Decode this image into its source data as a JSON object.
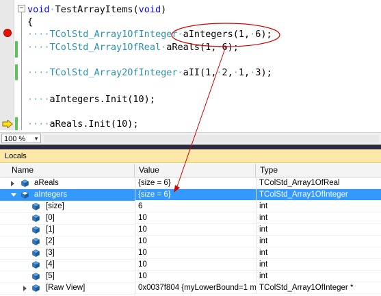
{
  "editor": {
    "lines": [
      {
        "parts": [
          {
            "t": "void",
            "c": "kw"
          },
          {
            "t": "·",
            "c": "dot"
          },
          {
            "t": "TestArrayItems(",
            "c": ""
          },
          {
            "t": "void",
            "c": "kw"
          },
          {
            "t": ")",
            "c": ""
          }
        ]
      },
      {
        "parts": [
          {
            "t": "{",
            "c": ""
          }
        ]
      },
      {
        "parts": [
          {
            "t": "····",
            "c": "dot"
          },
          {
            "t": "TColStd_Array1OfInteger",
            "c": "ty"
          },
          {
            "t": "·",
            "c": "dot"
          },
          {
            "t": "aIntegers(1,",
            "c": ""
          },
          {
            "t": "·",
            "c": "dot"
          },
          {
            "t": "6);",
            "c": ""
          }
        ]
      },
      {
        "parts": [
          {
            "t": "····",
            "c": "dot"
          },
          {
            "t": "TColStd_Array1OfReal",
            "c": "ty"
          },
          {
            "t": "·",
            "c": "dot"
          },
          {
            "t": "aReals(1,",
            "c": ""
          },
          {
            "t": "·",
            "c": "dot"
          },
          {
            "t": "6);",
            "c": ""
          }
        ]
      },
      {
        "parts": []
      },
      {
        "parts": [
          {
            "t": "····",
            "c": "dot"
          },
          {
            "t": "TColStd_Array2OfInteger",
            "c": "ty"
          },
          {
            "t": "·",
            "c": "dot"
          },
          {
            "t": "aII(1,",
            "c": ""
          },
          {
            "t": "·",
            "c": "dot"
          },
          {
            "t": "2,",
            "c": ""
          },
          {
            "t": "·",
            "c": "dot"
          },
          {
            "t": "1,",
            "c": ""
          },
          {
            "t": "·",
            "c": "dot"
          },
          {
            "t": "3);",
            "c": ""
          }
        ]
      },
      {
        "parts": []
      },
      {
        "parts": [
          {
            "t": "····",
            "c": "dot"
          },
          {
            "t": "aIntegers.Init(10);",
            "c": ""
          }
        ]
      },
      {
        "parts": []
      },
      {
        "parts": [
          {
            "t": "····",
            "c": "dot"
          },
          {
            "t": "aReals.Init(10);",
            "c": ""
          }
        ]
      }
    ],
    "collapse_glyph": "−",
    "zoom": "100 %",
    "zoom_caret": "▼"
  },
  "locals": {
    "title": "Locals",
    "columns": [
      "Name",
      "Value",
      "Type"
    ],
    "rows": [
      {
        "name": "aReals",
        "value": "{size = 6}",
        "type": "TColStd_Array1OfReal",
        "depth": 0,
        "expander": "closed",
        "selected": false
      },
      {
        "name": "aIntegers",
        "value": "{size = 6}",
        "type": "TColStd_Array1OfInteger",
        "depth": 0,
        "expander": "open",
        "selected": true
      },
      {
        "name": "[size]",
        "value": "6",
        "type": "int",
        "depth": 1,
        "expander": "none",
        "selected": false
      },
      {
        "name": "[0]",
        "value": "10",
        "type": "int",
        "depth": 1,
        "expander": "none",
        "selected": false
      },
      {
        "name": "[1]",
        "value": "10",
        "type": "int",
        "depth": 1,
        "expander": "none",
        "selected": false
      },
      {
        "name": "[2]",
        "value": "10",
        "type": "int",
        "depth": 1,
        "expander": "none",
        "selected": false
      },
      {
        "name": "[3]",
        "value": "10",
        "type": "int",
        "depth": 1,
        "expander": "none",
        "selected": false
      },
      {
        "name": "[4]",
        "value": "10",
        "type": "int",
        "depth": 1,
        "expander": "none",
        "selected": false
      },
      {
        "name": "[5]",
        "value": "10",
        "type": "int",
        "depth": 1,
        "expander": "none",
        "selected": false
      },
      {
        "name": "[Raw View]",
        "value": "0x0037f804 {myLowerBound=1 m",
        "type": "TColStd_Array1OfInteger *",
        "depth": 1,
        "expander": "closed",
        "selected": false
      }
    ]
  },
  "colors": {
    "breakpoint": "#e51400",
    "selection": "#3399ff",
    "annotation": "#d40000",
    "locals_title_bg": "#fbe8a8"
  }
}
